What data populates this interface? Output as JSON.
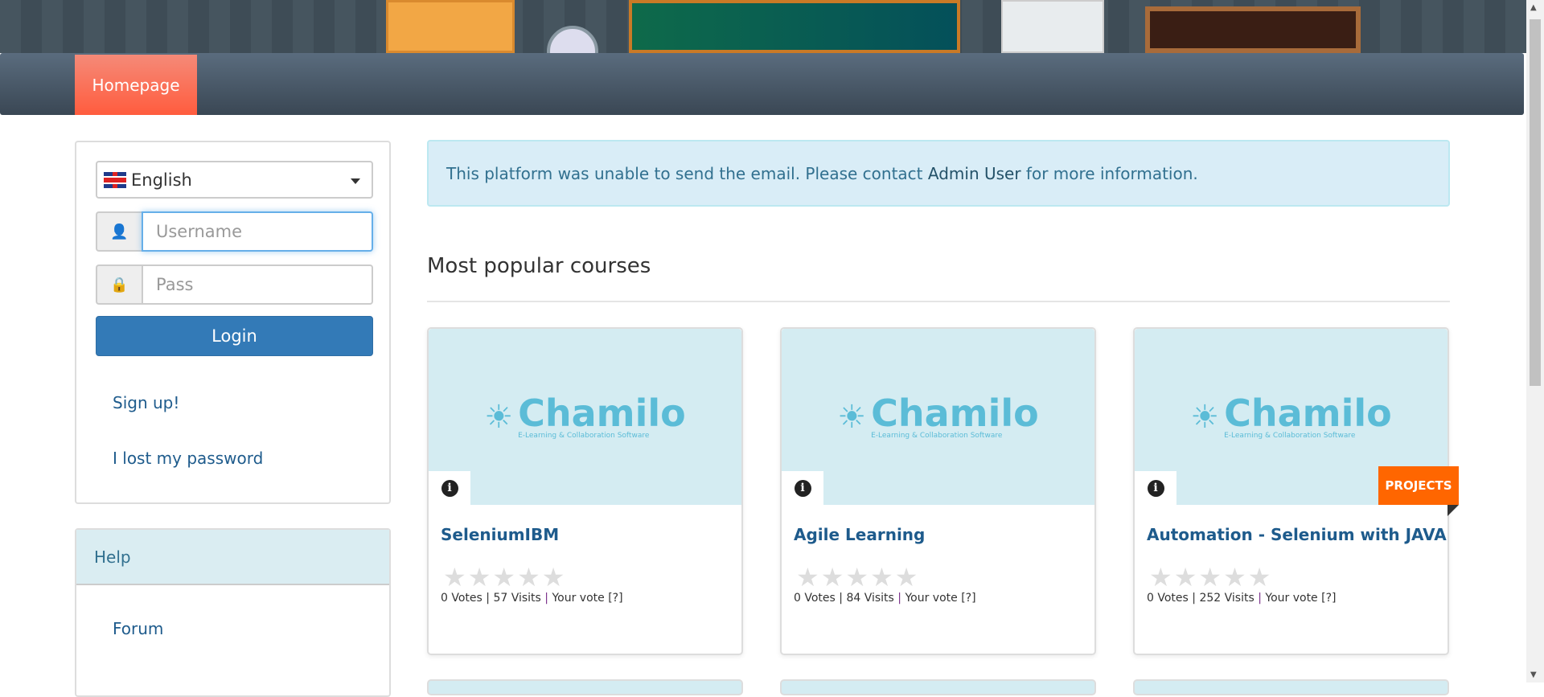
{
  "nav": {
    "tab": "Homepage"
  },
  "login": {
    "language": "English",
    "username_placeholder": "Username",
    "password_placeholder": "Pass",
    "login_label": "Login",
    "signup": "Sign up!",
    "lost_password": "I lost my password"
  },
  "help": {
    "title": "Help",
    "forum": "Forum"
  },
  "alert": {
    "pre": "This platform was unable to send the email. Please contact ",
    "link": "Admin User",
    "post": " for more information."
  },
  "section_title": "Most popular courses",
  "courses": [
    {
      "title": "SeleniumIBM",
      "votes": "0 Votes",
      "visits": "57 Visits",
      "your_vote": "Your vote [?]",
      "rating": 0
    },
    {
      "title": "Agile Learning",
      "votes": "0 Votes",
      "visits": "84 Visits",
      "your_vote": "Your vote [?]",
      "rating": 0
    },
    {
      "title": "Automation - Selenium with JAVA",
      "votes": "0 Votes",
      "visits": "252 Visits",
      "your_vote": "Your vote [?]",
      "rating": 0,
      "badge": "PROJECTS"
    }
  ],
  "logo": {
    "name": "Chamilo",
    "tagline": "E-Learning & Collaboration Software"
  },
  "colors": {
    "nav_tab": "#ff5c3e",
    "badge": "#ff6600",
    "primary": "#337ab7"
  }
}
